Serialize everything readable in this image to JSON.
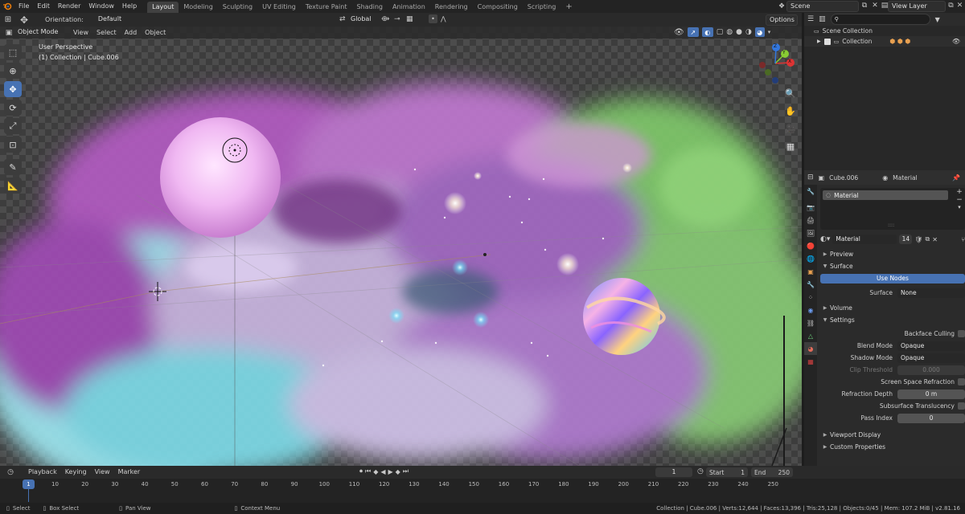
{
  "topbar": {
    "menus": [
      "File",
      "Edit",
      "Render",
      "Window",
      "Help"
    ],
    "workspaces": [
      "Layout",
      "Modeling",
      "Sculpting",
      "UV Editing",
      "Texture Paint",
      "Shading",
      "Animation",
      "Rendering",
      "Compositing",
      "Scripting"
    ],
    "active_workspace": "Layout",
    "scene_name": "Scene",
    "view_layer_name": "View Layer"
  },
  "viewport_header": {
    "orientation_label": "Orientation:",
    "orientation_value": "Default",
    "transform_orientation": "Global",
    "options_label": "Options",
    "mode": "Object Mode",
    "menus": [
      "View",
      "Select",
      "Add",
      "Object"
    ]
  },
  "viewport": {
    "overlay_line1": "User Perspective",
    "overlay_line2": "(1) Collection | Cube.006",
    "gizmo_axes": {
      "x": "X",
      "y": "Y",
      "z": "Z"
    }
  },
  "outliner": {
    "search_placeholder": "",
    "scene_collection": "Scene Collection",
    "collection": "Collection"
  },
  "properties": {
    "object_name": "Cube.006",
    "material_tab": "Material",
    "slot_name": "Material",
    "material_name": "Material",
    "user_count": "14",
    "panels": {
      "preview": "Preview",
      "surface": "Surface",
      "use_nodes": "Use Nodes",
      "surface_label": "Surface",
      "surface_value": "None",
      "volume": "Volume",
      "settings": "Settings",
      "backface_culling": "Backface Culling",
      "blend_mode_label": "Blend Mode",
      "blend_mode_value": "Opaque",
      "shadow_mode_label": "Shadow Mode",
      "shadow_mode_value": "Opaque",
      "clip_threshold_label": "Clip Threshold",
      "clip_threshold_value": "0.000",
      "ssr_label": "Screen Space Refraction",
      "refraction_depth_label": "Refraction Depth",
      "refraction_depth_value": "0 m",
      "sss_label": "Subsurface Translucency",
      "pass_index_label": "Pass Index",
      "pass_index_value": "0",
      "viewport_display": "Viewport Display",
      "custom_properties": "Custom Properties"
    }
  },
  "timeline": {
    "menus": [
      "Playback",
      "Keying",
      "View",
      "Marker"
    ],
    "current_frame": "1",
    "start_label": "Start",
    "start_value": "1",
    "end_label": "End",
    "end_value": "250",
    "ticks": [
      "1",
      "10",
      "20",
      "30",
      "40",
      "50",
      "60",
      "70",
      "80",
      "90",
      "100",
      "110",
      "120",
      "130",
      "140",
      "150",
      "160",
      "170",
      "180",
      "190",
      "200",
      "210",
      "220",
      "230",
      "240",
      "250"
    ]
  },
  "statusbar": {
    "select": "Select",
    "box_select": "Box Select",
    "pan_view": "Pan View",
    "context_menu": "Context Menu",
    "stats": "Collection | Cube.006 | Verts:12,644 | Faces:13,396 | Tris:25,128 | Objects:0/45 | Mem: 107.2 MiB | v2.81.16"
  },
  "colors": {
    "accent": "#4772b3",
    "bg": "#1d1d1d",
    "panel": "#303030",
    "field": "#545454"
  }
}
